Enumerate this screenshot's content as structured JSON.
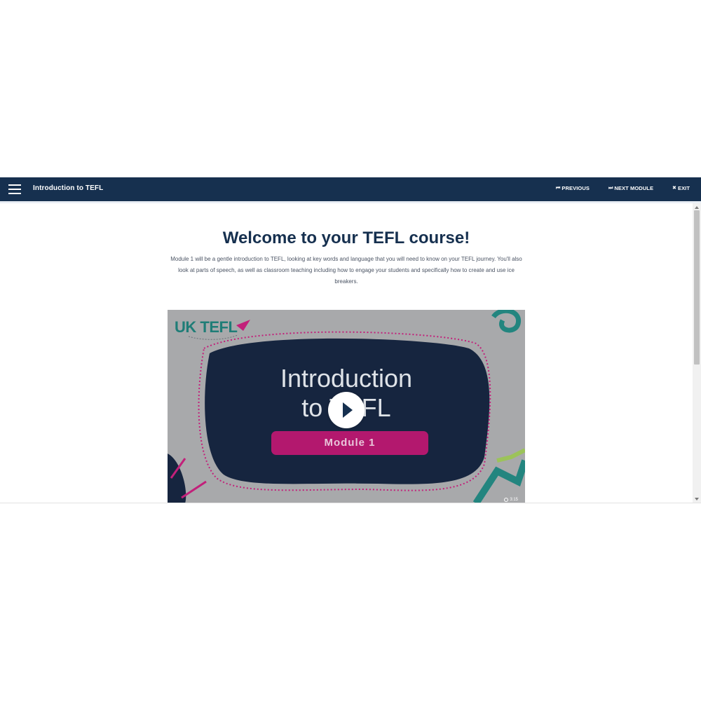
{
  "header": {
    "course_title": "Introduction to TEFL",
    "previous_label": "PREVIOUS",
    "next_label": "NEXT MODULE",
    "exit_label": "EXIT"
  },
  "main": {
    "heading": "Welcome to your TEFL course!",
    "intro": "Module 1 will be a gentle introduction to TEFL, looking at key words and language that you will need to know on your TEFL journey. You'll also look at parts of speech, as well as classroom teaching including how to engage your students and specifically how to create and use ice breakers."
  },
  "video": {
    "logo_text": "UK TEFL",
    "title_line1": "Introduction",
    "title_line2": "to TEFL",
    "module_label": "Module 1",
    "duration": "3:15"
  },
  "colors": {
    "navy": "#16304f",
    "magenta": "#b3186e",
    "teal": "#1f7d77",
    "video_bg": "#a8a9ab"
  }
}
